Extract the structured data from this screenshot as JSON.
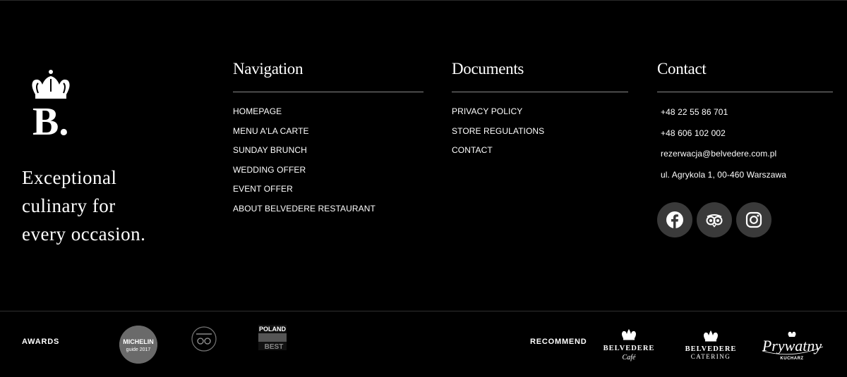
{
  "brand": {
    "logo_letter": "B.",
    "tagline": [
      "Exceptional",
      "culinary for",
      "every occasion."
    ]
  },
  "navigation": {
    "title": "Navigation",
    "items": [
      "HOMEPAGE",
      "MENU A'LA CARTE",
      "SUNDAY BRUNCH",
      "WEDDING OFFER",
      "EVENT OFFER",
      "ABOUT BELVEDERE RESTAURANT"
    ]
  },
  "documents": {
    "title": "Documents",
    "items": [
      "PRIVACY POLICY",
      "STORE REGULATIONS",
      "CONTACT"
    ]
  },
  "contact": {
    "title": "Contact",
    "phone1": "+48 22 55 86 701",
    "phone2": "+48 606 102 002",
    "email": "rezerwacja@belvedere.com.pl",
    "address": "ul. Agrykola 1, 00-460 Warszawa",
    "socials": [
      "facebook-icon",
      "tripadvisor-icon",
      "instagram-icon"
    ]
  },
  "footer": {
    "awards_label": "AWARDS",
    "recommend_label": "RECOMMEND",
    "michelin": {
      "line1": "MICHELIN",
      "line2": "guide 2017"
    },
    "poland": {
      "line1": "POLAND",
      "line2": "BEST"
    },
    "belvedere_cafe": {
      "name": "BELVEDERE",
      "sub": "Café"
    },
    "belvedere_catering": {
      "name": "BELVEDERE",
      "sub": "CATERING"
    },
    "prywatny": {
      "name": "Prywatny",
      "sub": "KUCHARZ"
    }
  },
  "colors": {
    "background": "#000000",
    "social_bg": "#3a3a3a",
    "rule": "#8a8a8a"
  }
}
